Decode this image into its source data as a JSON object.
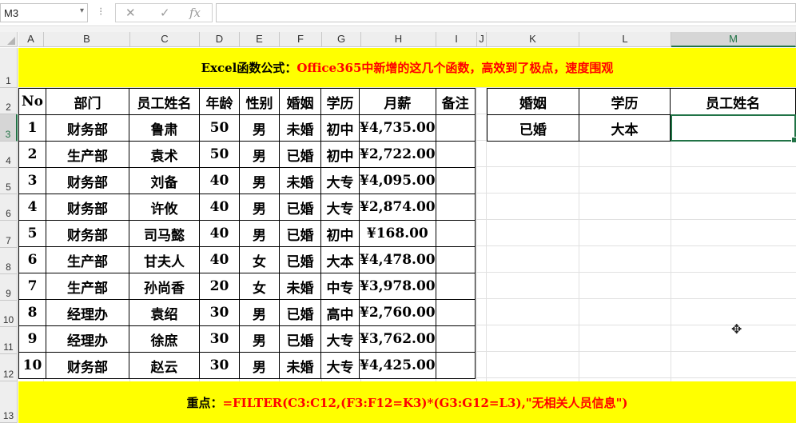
{
  "formula_bar": {
    "name_box": "M3",
    "cancel_icon": "✕",
    "enter_icon": "✓",
    "fx_label": "fx",
    "value": ""
  },
  "columns": [
    "A",
    "B",
    "C",
    "D",
    "E",
    "F",
    "G",
    "H",
    "I",
    "J",
    "K",
    "L",
    "M"
  ],
  "selected_column": "M",
  "rows": [
    "1",
    "2",
    "3",
    "4",
    "5",
    "6",
    "7",
    "8",
    "9",
    "10",
    "11",
    "12",
    "13"
  ],
  "selected_row": "3",
  "title_banner": {
    "prefix": "Excel函数公式：",
    "highlight": "Office365中新增的这几个函数，高效到了极点，速度围观"
  },
  "data_table": {
    "headers": [
      "No",
      "部门",
      "员工姓名",
      "年龄",
      "性别",
      "婚姻",
      "学历",
      "月薪",
      "备注"
    ],
    "rows": [
      [
        "1",
        "财务部",
        "鲁肃",
        "50",
        "男",
        "未婚",
        "初中",
        "¥4,735.00",
        ""
      ],
      [
        "2",
        "生产部",
        "袁术",
        "50",
        "男",
        "已婚",
        "初中",
        "¥2,722.00",
        ""
      ],
      [
        "3",
        "财务部",
        "刘备",
        "40",
        "男",
        "未婚",
        "大专",
        "¥4,095.00",
        ""
      ],
      [
        "4",
        "财务部",
        "许攸",
        "40",
        "男",
        "已婚",
        "大专",
        "¥2,874.00",
        ""
      ],
      [
        "5",
        "财务部",
        "司马懿",
        "40",
        "男",
        "已婚",
        "初中",
        "¥168.00",
        ""
      ],
      [
        "6",
        "生产部",
        "甘夫人",
        "40",
        "女",
        "已婚",
        "大本",
        "¥4,478.00",
        ""
      ],
      [
        "7",
        "生产部",
        "孙尚香",
        "20",
        "女",
        "未婚",
        "中专",
        "¥3,978.00",
        ""
      ],
      [
        "8",
        "经理办",
        "袁绍",
        "30",
        "男",
        "已婚",
        "高中",
        "¥2,760.00",
        ""
      ],
      [
        "9",
        "经理办",
        "徐庶",
        "30",
        "男",
        "已婚",
        "大专",
        "¥3,762.00",
        ""
      ],
      [
        "10",
        "财务部",
        "赵云",
        "30",
        "男",
        "未婚",
        "大专",
        "¥4,425.00",
        ""
      ]
    ]
  },
  "criteria_table": {
    "headers": [
      "婚姻",
      "学历",
      "员工姓名"
    ],
    "values": [
      "已婚",
      "大本",
      ""
    ]
  },
  "bottom_banner": {
    "prefix": "重点：",
    "formula": "=FILTER(C3:C12,(F3:F12=K3)*(G3:G12=L3),\"无相关人员信息\")"
  },
  "colors": {
    "banner": "#ffff00",
    "accent": "#217346",
    "highlight_text": "#ff0000"
  }
}
